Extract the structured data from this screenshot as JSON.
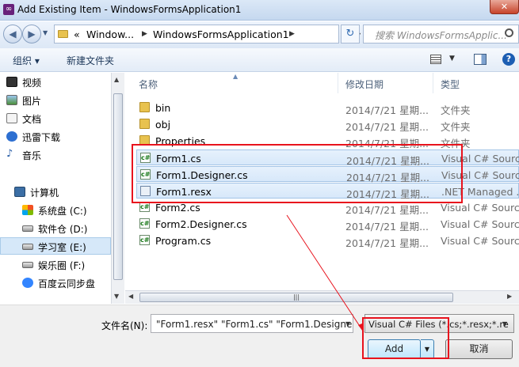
{
  "window": {
    "title": "Add Existing Item - WindowsFormsApplication1",
    "close_glyph": "✕",
    "app_icon_glyph": "∞"
  },
  "address": {
    "overflow": "«",
    "crumbs": [
      "Window...",
      "WindowsFormsApplication1"
    ],
    "search_placeholder": "搜索 WindowsFormsApplic..."
  },
  "toolbar": {
    "organize": "组织 ▾",
    "new_folder": "新建文件夹"
  },
  "sidebar": {
    "items": [
      "视频",
      "图片",
      "文档",
      "迅雷下载",
      "音乐",
      "计算机",
      "系统盘 (C:)",
      "软件仓 (D:)",
      "学习室 (E:)",
      "娱乐圈 (F:)",
      "百度云同步盘"
    ],
    "selected_index": 8
  },
  "columns": {
    "name": "名称",
    "date": "修改日期",
    "type": "类型"
  },
  "files": [
    {
      "name": "bin",
      "date": "2014/7/21 星期...",
      "type": "文件夹",
      "kind": "folder"
    },
    {
      "name": "obj",
      "date": "2014/7/21 星期...",
      "type": "文件夹",
      "kind": "folder"
    },
    {
      "name": "Properties",
      "date": "2014/7/21 星期...",
      "type": "文件夹",
      "kind": "folder"
    },
    {
      "name": "Form1.cs",
      "date": "2014/7/21 星期...",
      "type": "Visual C# Sourc...",
      "kind": "cs",
      "selected": true
    },
    {
      "name": "Form1.Designer.cs",
      "date": "2014/7/21 星期...",
      "type": "Visual C# Sourc...",
      "kind": "cs",
      "selected": true
    },
    {
      "name": "Form1.resx",
      "date": "2014/7/21 星期...",
      "type": ".NET Managed ...",
      "kind": "resx",
      "selected": true
    },
    {
      "name": "Form2.cs",
      "date": "2014/7/21 星期...",
      "type": "Visual C# Sourc...",
      "kind": "cs"
    },
    {
      "name": "Form2.Designer.cs",
      "date": "2014/7/21 星期...",
      "type": "Visual C# Sourc...",
      "kind": "cs"
    },
    {
      "name": "Program.cs",
      "date": "2014/7/21 星期...",
      "type": "Visual C# Sourc...",
      "kind": "cs"
    }
  ],
  "footer": {
    "filename_label": "文件名(N):",
    "filename_value": "\"Form1.resx\" \"Form1.cs\" \"Form1.Designe",
    "filetype_value": "Visual C# Files (*.cs;*.resx;*.re",
    "add_label": "Add",
    "cancel_label": "取消"
  },
  "colors": {
    "highlight": "#e8131d",
    "selection": "#d7e8fa"
  }
}
